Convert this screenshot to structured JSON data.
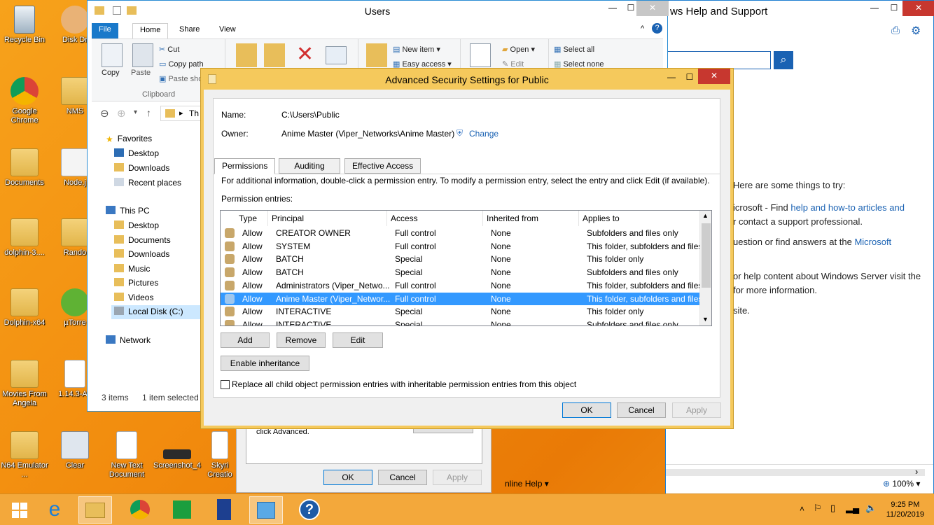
{
  "desktop": {
    "icons": [
      {
        "label": "Recycle Bin"
      },
      {
        "label": "Disk Dr"
      },
      {
        "label": "Google Chrome"
      },
      {
        "label": "NMS"
      },
      {
        "label": "Documents"
      },
      {
        "label": "Node.j"
      },
      {
        "label": "dolphin-3...."
      },
      {
        "label": "Rando"
      },
      {
        "label": "Dolphin-x64"
      },
      {
        "label": "µTorre"
      },
      {
        "label": "Movies From Angela"
      },
      {
        "label": "1.14.3-Ari"
      },
      {
        "label": "N64 Emulator ..."
      },
      {
        "label": "Clear"
      },
      {
        "label": "New Text Document"
      },
      {
        "label": "Screenshot_4"
      },
      {
        "label": "Skyri Creatio"
      }
    ]
  },
  "help_window": {
    "title": "ws Help and Support",
    "lines": [
      "Here are some things to try:",
      "icrosoft - Find ",
      "help and how-to articles and",
      "r contact a support professional.",
      "uestion or find answers at the ",
      "Microsoft",
      "or help content about Windows Server visit the",
      "for more information.",
      "site."
    ],
    "online_help": "nline Help ▾",
    "zoom": "100% ▾"
  },
  "explorer": {
    "title": "Users",
    "tabs": {
      "file": "File",
      "home": "Home",
      "share": "Share",
      "view": "View"
    },
    "ribbon": {
      "copy": "Copy",
      "paste": "Paste",
      "cut": "Cut",
      "copy_path": "Copy path",
      "paste_shortcut": "Paste sho",
      "clipboard": "Clipboard",
      "new_item": "New item ▾",
      "easy_access": "Easy access ▾",
      "open": "Open ▾",
      "edit": "Edit",
      "select_all": "Select all",
      "select_none": "Select none"
    },
    "address": "Th",
    "nav": {
      "favorites": "Favorites",
      "desktop": "Desktop",
      "downloads": "Downloads",
      "recent": "Recent places",
      "this_pc": "This PC",
      "pc_desktop": "Desktop",
      "documents": "Documents",
      "pc_downloads": "Downloads",
      "music": "Music",
      "pictures": "Pictures",
      "videos": "Videos",
      "local_disk": "Local Disk (C:)",
      "network": "Network"
    },
    "status": {
      "items": "3 items",
      "selected": "1 item selected"
    }
  },
  "back_dialog": {
    "text": "click Advanced.",
    "ok": "OK",
    "cancel": "Cancel",
    "apply": "Apply"
  },
  "adv": {
    "title": "Advanced Security Settings for Public",
    "name_label": "Name:",
    "name_value": "C:\\Users\\Public",
    "owner_label": "Owner:",
    "owner_value": "Anime Master (Viper_Networks\\Anime Master)",
    "change": "Change",
    "tabs": {
      "permissions": "Permissions",
      "auditing": "Auditing",
      "effective": "Effective Access"
    },
    "info": "For additional information, double-click a permission entry. To modify a permission entry, select the entry and click Edit (if available).",
    "entries_label": "Permission entries:",
    "columns": {
      "type": "Type",
      "principal": "Principal",
      "access": "Access",
      "inherited": "Inherited from",
      "applies": "Applies to"
    },
    "rows": [
      {
        "type": "Allow",
        "principal": "CREATOR OWNER",
        "access": "Full control",
        "inherited": "None",
        "applies": "Subfolders and files only"
      },
      {
        "type": "Allow",
        "principal": "SYSTEM",
        "access": "Full control",
        "inherited": "None",
        "applies": "This folder, subfolders and files"
      },
      {
        "type": "Allow",
        "principal": "BATCH",
        "access": "Special",
        "inherited": "None",
        "applies": "This folder only"
      },
      {
        "type": "Allow",
        "principal": "BATCH",
        "access": "Special",
        "inherited": "None",
        "applies": "Subfolders and files only"
      },
      {
        "type": "Allow",
        "principal": "Administrators (Viper_Netwo...",
        "access": "Full control",
        "inherited": "None",
        "applies": "This folder, subfolders and files"
      },
      {
        "type": "Allow",
        "principal": "Anime Master (Viper_Networ...",
        "access": "Full control",
        "inherited": "None",
        "applies": "This folder, subfolders and files"
      },
      {
        "type": "Allow",
        "principal": "INTERACTIVE",
        "access": "Special",
        "inherited": "None",
        "applies": "This folder only"
      },
      {
        "type": "Allow",
        "principal": "INTERACTIVE",
        "access": "Special",
        "inherited": "None",
        "applies": "Subfolders and files only"
      }
    ],
    "add": "Add",
    "remove": "Remove",
    "edit": "Edit",
    "enable_inheritance": "Enable inheritance",
    "replace_label": "Replace all child object permission entries with inheritable permission entries from this object",
    "ok": "OK",
    "cancel": "Cancel",
    "apply": "Apply"
  },
  "taskbar": {
    "time": "9:25 PM",
    "date": "11/20/2019"
  }
}
